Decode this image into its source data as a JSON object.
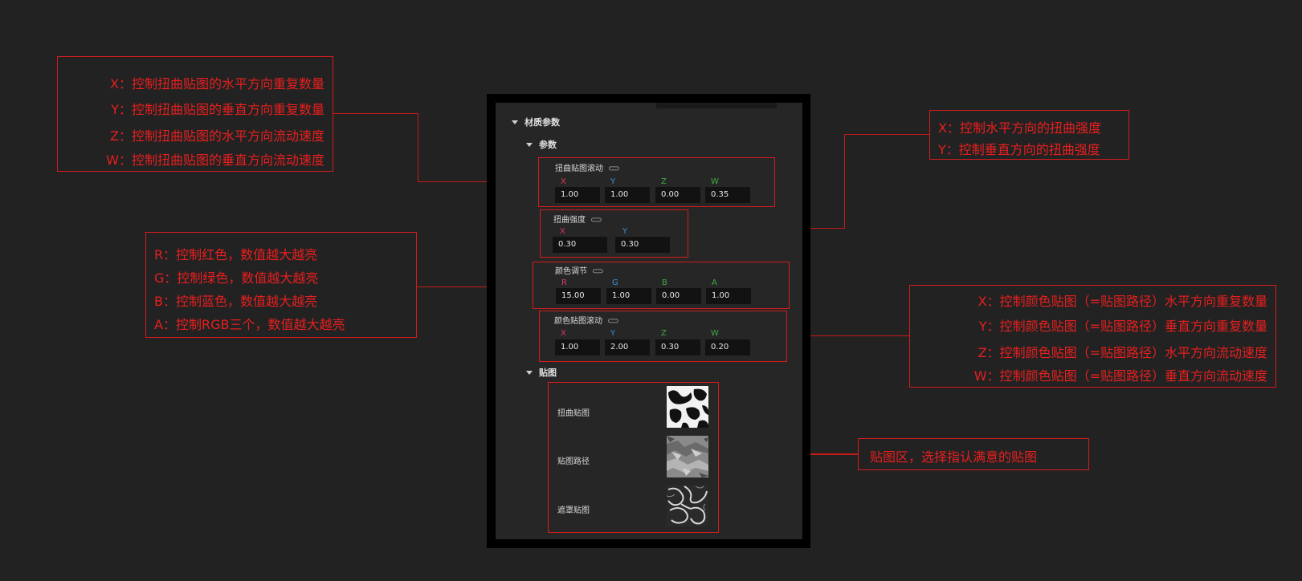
{
  "panel": {
    "section_material": "材质参数",
    "section_params": "参数",
    "section_textures": "贴图",
    "params": [
      {
        "label": "扭曲贴图滚动",
        "link_icon": "link-icon",
        "fields": [
          {
            "axis": "X",
            "value": "1.00"
          },
          {
            "axis": "Y",
            "value": "1.00"
          },
          {
            "axis": "Z",
            "value": "0.00"
          },
          {
            "axis": "W",
            "value": "0.35"
          }
        ]
      },
      {
        "label": "扭曲强度",
        "link_icon": "link-icon",
        "fields": [
          {
            "axis": "X",
            "value": "0.30"
          },
          {
            "axis": "Y",
            "value": "0.30"
          }
        ]
      },
      {
        "label": "颜色调节",
        "link_icon": "link-icon",
        "fields": [
          {
            "axis": "R",
            "value": "15.00"
          },
          {
            "axis": "G",
            "value": "1.00"
          },
          {
            "axis": "B",
            "value": "0.00"
          },
          {
            "axis": "A",
            "value": "1.00"
          }
        ]
      },
      {
        "label": "颜色贴图滚动",
        "link_icon": "link-icon",
        "fields": [
          {
            "axis": "X",
            "value": "1.00"
          },
          {
            "axis": "Y",
            "value": "2.00"
          },
          {
            "axis": "Z",
            "value": "0.30"
          },
          {
            "axis": "W",
            "value": "0.20"
          }
        ]
      }
    ],
    "textures": [
      {
        "label": "扭曲贴图"
      },
      {
        "label": "贴图路径"
      },
      {
        "label": "遮罩贴图"
      }
    ]
  },
  "notes": {
    "distort_scroll": [
      "X：控制扭曲贴图的水平方向重复数量",
      "Y：控制扭曲贴图的垂直方向重复数量",
      "Z：控制扭曲贴图的水平方向流动速度",
      "W：控制扭曲贴图的垂直方向流动速度"
    ],
    "distort_strength": [
      "X：控制水平方向的扭曲强度",
      "Y：控制垂直方向的扭曲强度"
    ],
    "color_adjust": [
      "R：控制红色，数值越大越亮",
      "G：控制绿色，数值越大越亮",
      "B：控制蓝色，数值越大越亮",
      "A：控制RGB三个，数值越大越亮"
    ],
    "color_scroll": [
      "X：控制颜色贴图（=贴图路径）水平方向重复数量",
      "Y：控制颜色贴图（=贴图路径）垂直方向重复数量",
      "Z：控制颜色贴图（=贴图路径）水平方向流动速度",
      "W：控制颜色贴图（=贴图路径）垂直方向流动速度"
    ],
    "texture_area": "贴图区，选择指认满意的贴图"
  },
  "colors": {
    "annotation_red": "#e81f1f",
    "axis_x": "#d93a5f",
    "axis_y": "#3f8fd8",
    "axis_z": "#3faa3f"
  }
}
